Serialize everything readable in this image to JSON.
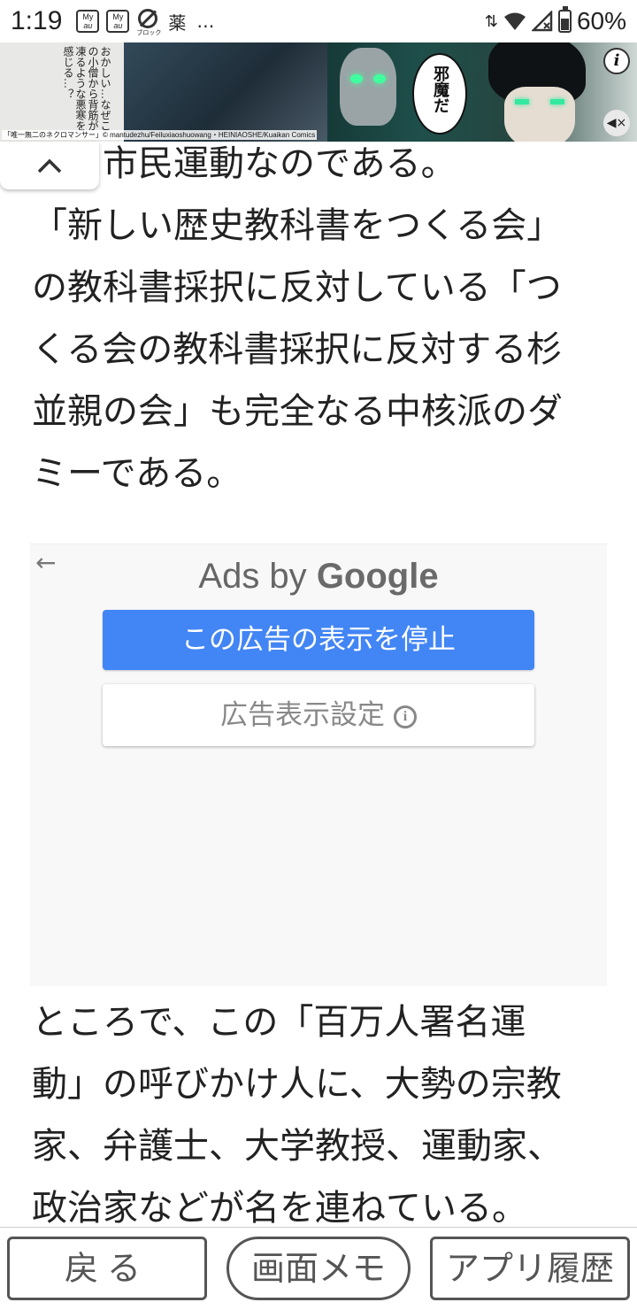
{
  "status_bar": {
    "time": "1:19",
    "notification_icons": [
      {
        "name": "my-au-icon",
        "line1": "My",
        "line2": "au"
      },
      {
        "name": "my-au-icon",
        "line1": "My",
        "line2": "au"
      }
    ],
    "block_icon_caption": "ブロック",
    "kanji_icon": "薬",
    "more": "…",
    "data_arrows": "⇅",
    "battery_percent": "60%",
    "battery_level": 0.6
  },
  "banner_ad": {
    "narration": "おかしい…なぜこの小僧から背筋が凍るような悪寒を感じる…？",
    "speech": "邪魔だ",
    "side_text": "け",
    "info_label": "i",
    "mute_label": "◀×",
    "credit": "「唯一無二のネクロマンサー」© mantudezhu/Feiluxiaoshuowang・HEINIAOSHE/Kuaikan Comics"
  },
  "collapse_button": {
    "icon": "chevron-up-icon"
  },
  "article": {
    "para1_clipped_line": "…と市民運動なのである。",
    "para1_lines": [
      "「新しい歴史教科書をつくる会」",
      "の教科書採択に反対している「つ",
      "くる会の教科書採択に反対する杉",
      "並親の会」も完全なる中核派のダ",
      "ミーである。"
    ],
    "para2_lines": [
      "ところで、この「百万人署名運",
      "動」の呼びかけ人に、大勢の宗教",
      "家、弁護士、大学教授、運動家、",
      "政治家などが名を連ねている。"
    ]
  },
  "ad_panel": {
    "back_arrow": "←",
    "ads_by": "Ads by",
    "google": "Google",
    "stop_button": "この広告の表示を停止",
    "settings_button": "広告表示設定",
    "settings_info": "i",
    "accent_color": "#4285f4"
  },
  "bottom_nav": {
    "back": "戻る",
    "memo": "画面メモ",
    "history": "アプリ履歴"
  }
}
